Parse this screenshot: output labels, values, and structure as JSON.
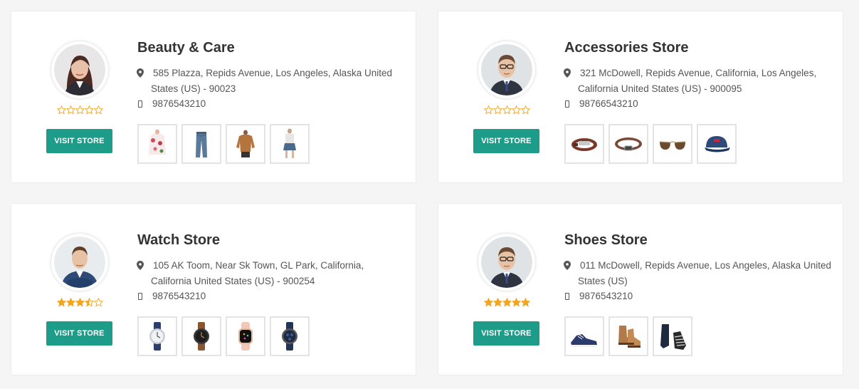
{
  "colors": {
    "accent": "#1e9c8a",
    "star": "#f4a41d",
    "page_bg": "#f5f5f5"
  },
  "stores": [
    {
      "name": "Beauty & Care",
      "address_line1": "585 Plazza, Repids Avenue, Los Angeles, Alaska United",
      "address_line2": "States (US) - 90023",
      "phone": "9876543210",
      "rating": 0,
      "button_label": "VISIT STORE",
      "avatar_icon": "woman-avatar-icon",
      "products": [
        "floral-blouse-icon",
        "jeans-icon",
        "sweater-icon",
        "denim-skirt-icon"
      ]
    },
    {
      "name": "Accessories Store",
      "address_line1": "321 McDowell, Repids Avenue, California, Los Angeles,",
      "address_line2": "California United States (US) - 900095",
      "phone": "98766543210",
      "rating": 0,
      "button_label": "VISIT STORE",
      "avatar_icon": "man-glasses-avatar-icon",
      "products": [
        "bracelet-icon",
        "belt-icon",
        "sunglasses-icon",
        "cap-icon"
      ]
    },
    {
      "name": "Watch Store",
      "address_line1": "105 AK Toom, Near Sk Town, GL Park, California,",
      "address_line2": "California United States (US) - 900254",
      "phone": "9876543210",
      "rating": 3.5,
      "button_label": "VISIT STORE",
      "avatar_icon": "man-suit-avatar-icon",
      "products": [
        "silver-watch-icon",
        "brown-watch-icon",
        "smartwatch-icon",
        "chronograph-watch-icon"
      ]
    },
    {
      "name": "Shoes Store",
      "address_line1": "011 McDowell, Repids Avenue, Los Angeles, Alaska United",
      "address_line2": "States (US)",
      "phone": "9876543210",
      "rating": 5,
      "button_label": "VISIT STORE",
      "avatar_icon": "man-glasses-avatar-icon",
      "products": [
        "sneaker-icon",
        "boots-icon",
        "slip-on-icon"
      ]
    }
  ]
}
